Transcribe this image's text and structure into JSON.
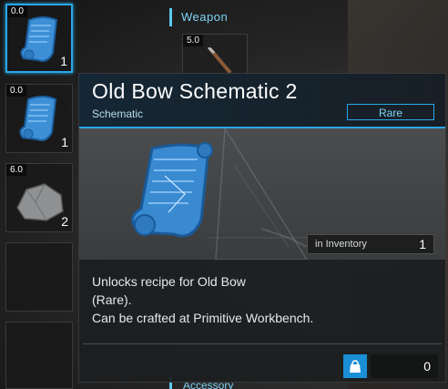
{
  "inventory": {
    "slots": [
      {
        "weight": "0.0",
        "quantity": "1",
        "icon": "schematic-icon",
        "selected": true
      },
      {
        "weight": "0.0",
        "quantity": "1",
        "icon": "schematic-icon",
        "selected": false
      },
      {
        "weight": "6.0",
        "quantity": "2",
        "icon": "stone-icon",
        "selected": false
      },
      {
        "weight": "",
        "quantity": "",
        "icon": "",
        "selected": false
      },
      {
        "weight": "",
        "quantity": "",
        "icon": "",
        "selected": false
      }
    ]
  },
  "equipment": {
    "weapon_label": "Weapon",
    "weapon_slot_weight": "5.0",
    "accessory_label": "Accessory"
  },
  "tooltip": {
    "title": "Old Bow Schematic 2",
    "type": "Schematic",
    "rarity": "Rare",
    "in_inventory_label": "in Inventory",
    "in_inventory_count": "1",
    "description": [
      "Unlocks recipe for Old Bow",
      "(Rare).",
      "Can be crafted at Primitive Workbench."
    ],
    "bag_count": "0"
  },
  "colors": {
    "accent": "#2aa7e8",
    "accent_text": "#7fd3f5",
    "panel": "#1c1e20"
  }
}
